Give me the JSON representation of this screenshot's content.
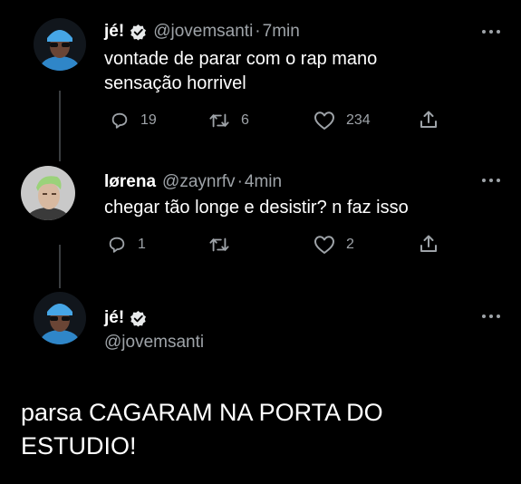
{
  "tweets": [
    {
      "name": "jé!",
      "handle": "@jovemsanti",
      "separator": "·",
      "time": "7min",
      "text_lines": [
        "vontade de parar com o rap mano",
        "sensação horrivel"
      ],
      "replies": "19",
      "retweets": "6",
      "likes": "234"
    },
    {
      "name": "lørena",
      "handle": "@zaynrfv",
      "separator": "·",
      "time": "4min",
      "text_lines": [
        "chegar tão longe e desistir? n faz isso"
      ],
      "replies": "1",
      "retweets": "",
      "likes": "2"
    }
  ],
  "main_tweet": {
    "name": "jé!",
    "handle": "@jovemsanti",
    "text_lines": [
      "parsa CAGARAM NA PORTA DO",
      "ESTUDIO!"
    ]
  },
  "icons": {
    "reply": "reply-icon",
    "retweet": "retweet-icon",
    "like": "heart-icon",
    "share": "share-icon",
    "verified": "verified-icon",
    "more": "more-icon"
  },
  "colors": {
    "background": "#000000",
    "text": "#ffffff",
    "muted": "#9ea3a8",
    "thread_line": "#3a3d40"
  }
}
